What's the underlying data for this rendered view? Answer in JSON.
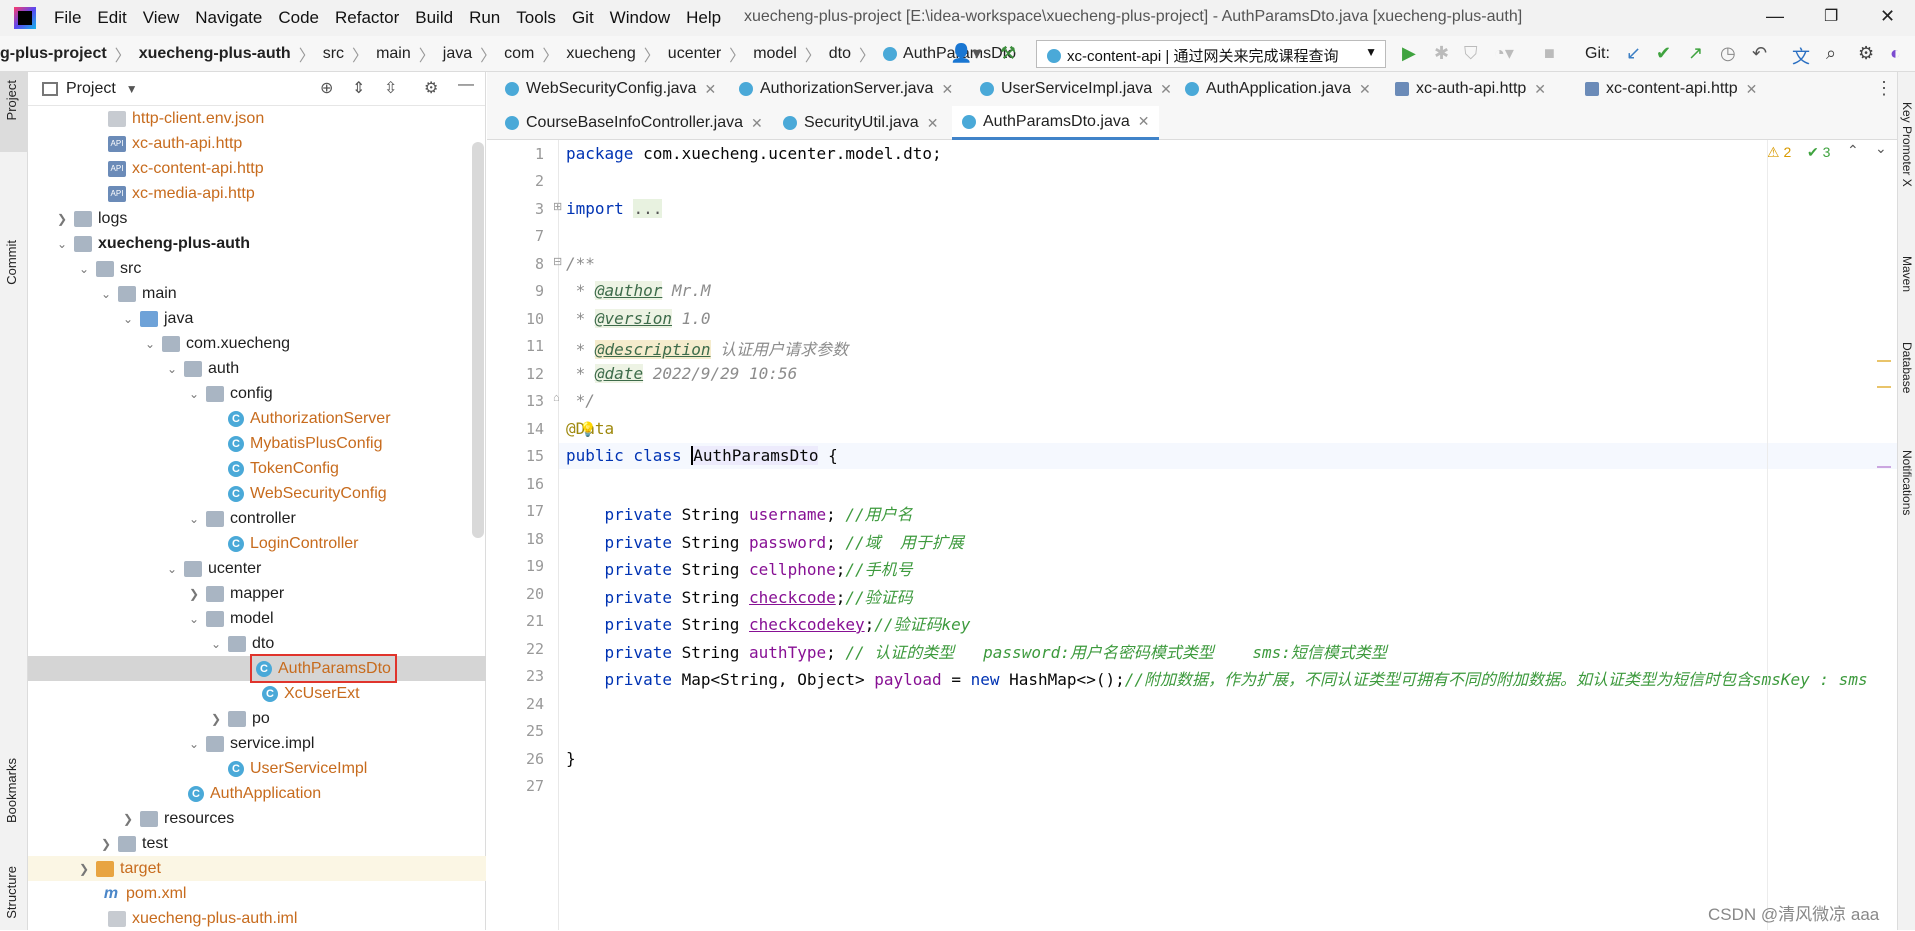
{
  "menubar": {
    "items": [
      "File",
      "Edit",
      "View",
      "Navigate",
      "Code",
      "Refactor",
      "Build",
      "Run",
      "Tools",
      "Git",
      "Window",
      "Help"
    ],
    "title": "xuecheng-plus-project [E:\\idea-workspace\\xuecheng-plus-project] - AuthParamsDto.java [xuecheng-plus-auth]"
  },
  "breadcrumb": [
    "g-plus-project",
    "xuecheng-plus-auth",
    "src",
    "main",
    "java",
    "com",
    "xuecheng",
    "ucenter",
    "model",
    "dto",
    "AuthParamsDto"
  ],
  "toolbar": {
    "run_config": "xc-content-api | 通过网关来完成课程查询",
    "git_label": "Git:"
  },
  "project_panel": {
    "title": "Project",
    "tree": [
      {
        "label": "http-client.env.json",
        "kind": "file"
      },
      {
        "label": "xc-auth-api.http",
        "kind": "api"
      },
      {
        "label": "xc-content-api.http",
        "kind": "api"
      },
      {
        "label": "xc-media-api.http",
        "kind": "api"
      },
      {
        "label": "logs",
        "kind": "folder"
      },
      {
        "label": "xuecheng-plus-auth",
        "kind": "folder"
      },
      {
        "label": "src",
        "kind": "folder"
      },
      {
        "label": "main",
        "kind": "folder"
      },
      {
        "label": "java",
        "kind": "folder"
      },
      {
        "label": "com.xuecheng",
        "kind": "pkg"
      },
      {
        "label": "auth",
        "kind": "pkg"
      },
      {
        "label": "config",
        "kind": "pkg"
      },
      {
        "label": "AuthorizationServer",
        "kind": "cls"
      },
      {
        "label": "MybatisPlusConfig",
        "kind": "cls"
      },
      {
        "label": "TokenConfig",
        "kind": "cls"
      },
      {
        "label": "WebSecurityConfig",
        "kind": "cls"
      },
      {
        "label": "controller",
        "kind": "pkg"
      },
      {
        "label": "LoginController",
        "kind": "cls"
      },
      {
        "label": "ucenter",
        "kind": "pkg"
      },
      {
        "label": "mapper",
        "kind": "pkg"
      },
      {
        "label": "model",
        "kind": "pkg"
      },
      {
        "label": "dto",
        "kind": "pkg"
      },
      {
        "label": "AuthParamsDto",
        "kind": "cls"
      },
      {
        "label": "XcUserExt",
        "kind": "cls"
      },
      {
        "label": "po",
        "kind": "pkg"
      },
      {
        "label": "service.impl",
        "kind": "pkg"
      },
      {
        "label": "UserServiceImpl",
        "kind": "cls"
      },
      {
        "label": "AuthApplication",
        "kind": "cls"
      },
      {
        "label": "resources",
        "kind": "folder"
      },
      {
        "label": "test",
        "kind": "folder"
      },
      {
        "label": "target",
        "kind": "folder"
      },
      {
        "label": "pom.xml",
        "kind": "mvn"
      },
      {
        "label": "xuecheng-plus-auth.iml",
        "kind": "file"
      }
    ]
  },
  "tabs_row1": [
    "WebSecurityConfig.java",
    "AuthorizationServer.java",
    "UserServiceImpl.java",
    "AuthApplication.java",
    "xc-auth-api.http",
    "xc-content-api.http"
  ],
  "tabs_row2": [
    "CourseBaseInfoController.java",
    "SecurityUtil.java",
    "AuthParamsDto.java"
  ],
  "editor": {
    "line_numbers": [
      "1",
      "2",
      "3",
      "7",
      "8",
      "9",
      "10",
      "11",
      "12",
      "13",
      "14",
      "15",
      "16",
      "17",
      "18",
      "19",
      "20",
      "21",
      "22",
      "23",
      "24",
      "25",
      "26",
      "27"
    ],
    "inspections": {
      "warnings": "2",
      "ok": "3"
    },
    "code": {
      "l1a": "package ",
      "l1b": "com.xuecheng.ucenter.model.dto;",
      "l3a": "import ",
      "l3b": "...",
      "l8": "/**",
      "l9a": " * ",
      "l9b": "@author",
      "l9c": " Mr.M",
      "l10a": " * ",
      "l10b": "@version",
      "l10c": " 1.0",
      "l11a": " * ",
      "l11b": "@description",
      "l11c": " 认证用户请求参数",
      "l12a": " * ",
      "l12b": "@date",
      "l12c": " 2022/9/29 10:56",
      "l13": " */",
      "l14": "@Data",
      "l15a": "public class ",
      "l15b": "AuthParamsDto",
      " l15c": " {",
      "l15c": " {",
      "l17a": "    private ",
      "l17b": "String ",
      "l17c": "username",
      "l17d": "; ",
      "l17e": "//用户名",
      "l18a": "    private ",
      "l18b": "String ",
      "l18c": "password",
      "l18d": "; ",
      "l18e": "//域  用于扩展",
      "l19a": "    private ",
      "l19b": "String ",
      "l19c": "cellphone",
      "l19d": ";",
      "l19e": "//手机号",
      "l20a": "    private ",
      "l20b": "String ",
      "l20c": "checkcode",
      "l20d": ";",
      "l20e": "//验证码",
      "l21a": "    private ",
      "l21b": "String ",
      "l21c": "checkcodekey",
      "l21d": ";",
      "l21e": "//验证码key",
      "l22a": "    private ",
      "l22b": "String ",
      "l22c": "authType",
      "l22d": "; ",
      "l22e": "// 认证的类型   password:用户名密码模式类型    sms:短信模式类型",
      "l23a": "    private ",
      "l23b": "Map<String, Object> ",
      "l23c": "payload",
      "l23d": " = ",
      "l23e": "new ",
      "l23f": "HashMap<>();",
      "l23g": "//附加数据，作为扩展，不同认证类型可拥有不同的附加数据。如认证类型为短信时包含smsKey : sms",
      "l26": "}"
    }
  },
  "side_left": [
    "Project",
    "Commit",
    "Bookmarks",
    "Structure"
  ],
  "side_right": [
    "Key Promoter X",
    "Maven",
    "Database",
    "Notifications"
  ],
  "watermark": "CSDN @清风微凉 aaa"
}
